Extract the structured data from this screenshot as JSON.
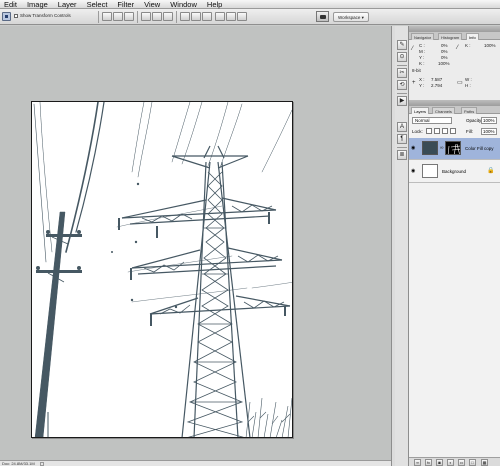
{
  "menu": [
    "Edit",
    "Image",
    "Layer",
    "Select",
    "Filter",
    "View",
    "Window",
    "Help"
  ],
  "options": {
    "transform_label": "Show Transform Controls",
    "workspace_label": "Workspace ▾"
  },
  "status": {
    "doc_info": "Doc: 24.8M/33.1M"
  },
  "panels": {
    "top_tabs": [
      "Navigator",
      "Histogram",
      "Info"
    ],
    "info": {
      "c_label": "C :",
      "c_val": "0%",
      "m_label": "M :",
      "m_val": "0%",
      "y_label": "Y :",
      "y_val": "0%",
      "k_label": "K :",
      "k_val": "100%",
      "bit_label": "8-bit",
      "k2_label": "K :",
      "k2_val": "100%",
      "x_label": "X :",
      "x_val": "7.587",
      "yy_label": "Y :",
      "yy_val": "2.794",
      "w_label": "W :",
      "h_label": "H :"
    },
    "layer_tabs": [
      "Layers",
      "Channels",
      "Paths"
    ],
    "layers": {
      "blend_mode": "Normal",
      "opacity_label": "Opacity:",
      "opacity_value": "100%",
      "lock_label": "Lock:",
      "fill_label": "Fill:",
      "fill_value": "100%",
      "items": [
        {
          "name": "Color Fill copy",
          "selected": true
        },
        {
          "name": "Background",
          "selected": false
        }
      ]
    },
    "footer_buttons": [
      "link",
      "fx",
      "mask",
      "adjust",
      "group",
      "new",
      "delete"
    ]
  },
  "colors": {
    "selection": "#9fb4db",
    "duotone": "#465863"
  }
}
